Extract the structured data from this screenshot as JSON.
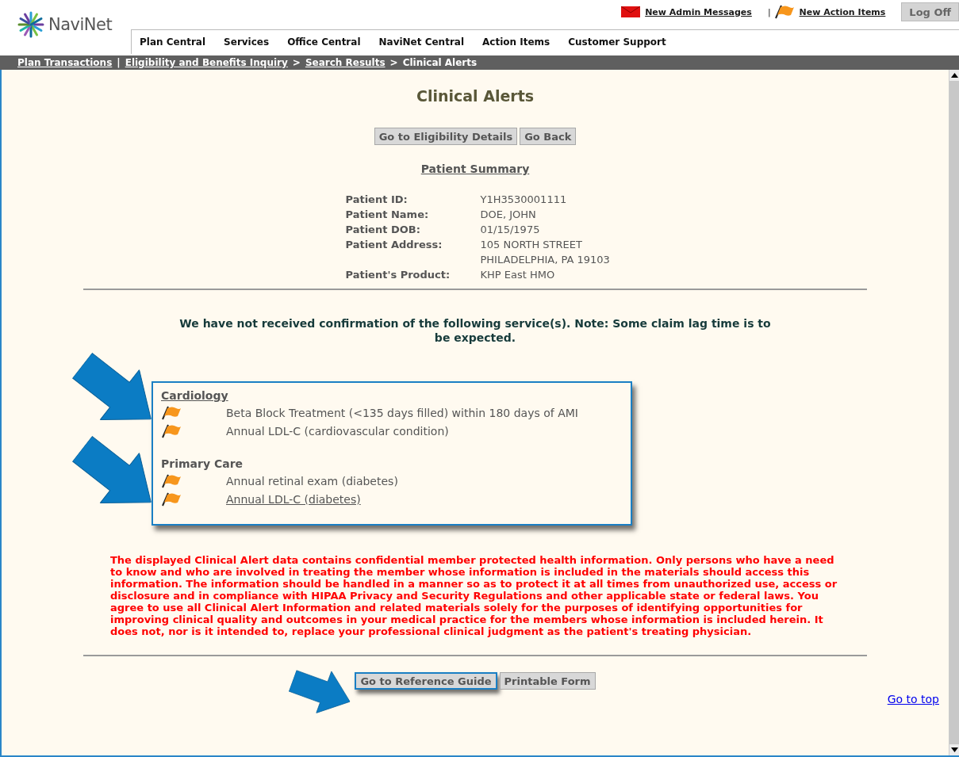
{
  "header": {
    "logo": "NaviNet",
    "top_links": [
      {
        "kind": "envelope",
        "label": "New Admin Messages"
      },
      {
        "kind": "flag",
        "label": "New Action Items"
      }
    ],
    "top_separator": "|",
    "log_off": "Log Off",
    "nav": [
      "Plan Central",
      "Services",
      "Office Central",
      "NaviNet Central",
      "Action Items",
      "Customer Support"
    ]
  },
  "breadcrumb": [
    {
      "kind": "link",
      "text": "Plan Transactions"
    },
    {
      "kind": "sep",
      "text": "|"
    },
    {
      "kind": "link",
      "text": "Eligibility and Benefits Inquiry"
    },
    {
      "kind": "sep",
      "text": ">"
    },
    {
      "kind": "link",
      "text": "Search Results"
    },
    {
      "kind": "sep",
      "text": ">"
    },
    {
      "kind": "current",
      "text": "Clinical Alerts"
    }
  ],
  "page_title": "Clinical Alerts",
  "top_buttons": [
    {
      "label": "Go to Eligibility Details",
      "highlighted": false
    },
    {
      "label": "Go Back",
      "highlighted": false
    }
  ],
  "patient_summary": {
    "heading": "Patient Summary",
    "fields": [
      {
        "label": "Patient ID:",
        "lines": [
          "Y1H3530001111"
        ]
      },
      {
        "label": "Patient Name:",
        "lines": [
          "DOE, JOHN"
        ]
      },
      {
        "label": "Patient DOB:",
        "lines": [
          "01/15/1975"
        ]
      },
      {
        "label": "Patient Address:",
        "lines": [
          "105 NORTH STREET",
          "PHILADELPHIA, PA 19103"
        ]
      },
      {
        "label": "Patient's Product:",
        "lines": [
          "KHP East HMO"
        ]
      }
    ]
  },
  "notice": "We have not received confirmation of the following service(s). Note: Some claim lag time is to be expected.",
  "alerts": {
    "highlighted": true,
    "groups": [
      {
        "title": "Cardiology",
        "link": true,
        "items": [
          {
            "text": "Beta Block Treatment (<135 days filled) within 180 days of AMI",
            "link": false
          },
          {
            "text": "Annual LDL-C (cardiovascular condition)",
            "link": false
          }
        ]
      },
      {
        "title": "Primary Care",
        "link": false,
        "items": [
          {
            "text": "Annual retinal exam (diabetes)",
            "link": false
          },
          {
            "text": "Annual LDL-C (diabetes)",
            "link": true
          }
        ]
      }
    ]
  },
  "disclaimer": "The displayed Clinical Alert data contains confidential member protected health information. Only persons who have a need to know and who are involved in treating the member whose information is included in the materials should access this information. The information should be handled in a manner so as to protect it at all times from unauthorized use, access or disclosure and in compliance with HIPAA Privacy and Security Regulations and other applicable state or federal laws. You agree to use all Clinical Alert Information and related materials solely for the purposes of identifying opportunities for improving clinical quality and outcomes in your medical practice for the members whose information is included herein. It does not, nor is it intended to, replace your professional clinical judgment as the patient's treating physician.",
  "bottom_buttons": [
    {
      "label": "Go to Reference Guide",
      "highlighted": true
    },
    {
      "label": "Printable Form",
      "highlighted": false
    }
  ],
  "go_to_top": "Go to top"
}
